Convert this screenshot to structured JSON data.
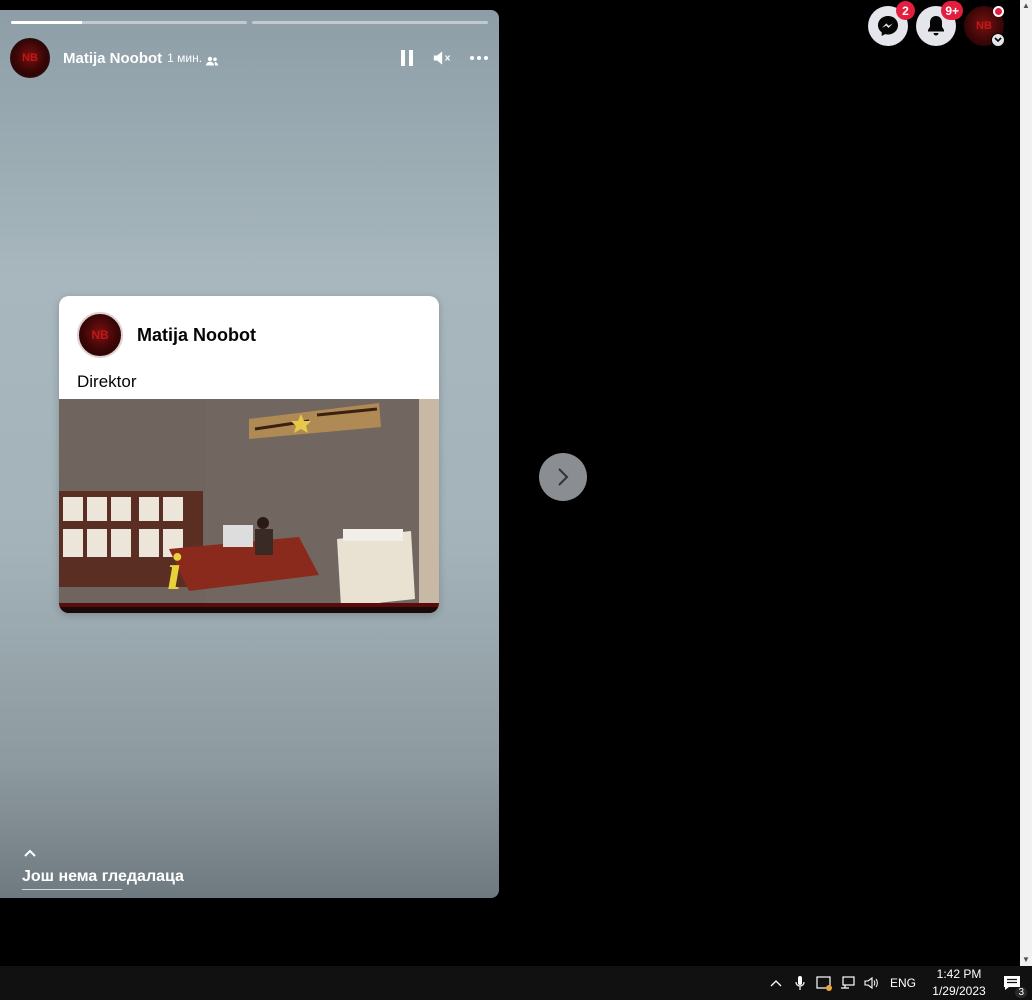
{
  "story": {
    "progress": [
      0.3,
      0.0,
      0.0
    ],
    "author": "Matija Noobot",
    "time": "1 мин.",
    "audience_icon": "friends-icon",
    "avatar_text": "NB",
    "post": {
      "author": "Matija Noobot",
      "text": "Direktor",
      "avatar_text": "NB"
    },
    "viewers_label": "Још нема гледалаца"
  },
  "topbar": {
    "messenger_badge": "2",
    "notifications_badge": "9+",
    "account_avatar_text": "NB"
  },
  "taskbar": {
    "lang": "ENG",
    "time": "1:42 PM",
    "date": "1/29/2023",
    "notifications_count": "3"
  }
}
